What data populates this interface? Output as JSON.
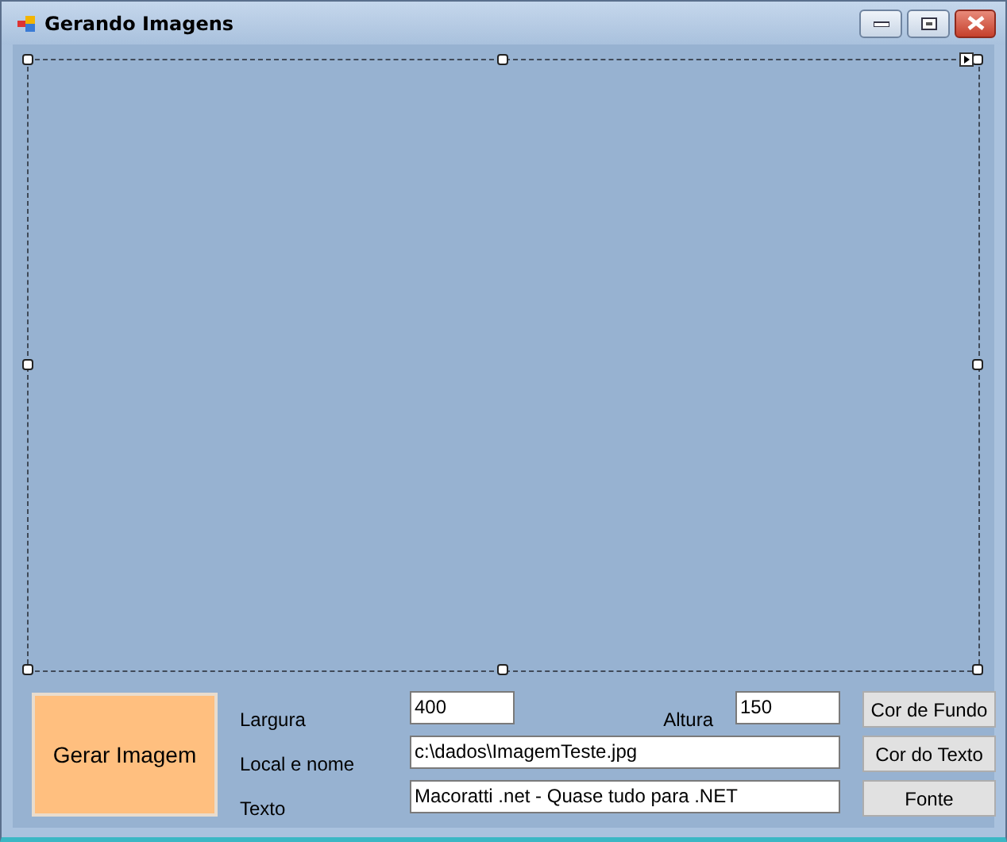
{
  "window": {
    "title": "Gerando Imagens"
  },
  "picture_box": {
    "selected": true
  },
  "generate_button": {
    "label": "Gerar Imagem"
  },
  "width_field": {
    "label": "Largura",
    "value": "400"
  },
  "height_field": {
    "label": "Altura",
    "value": "150"
  },
  "path_field": {
    "label": "Local e nome",
    "value": "c:\\dados\\ImagemTeste.jpg"
  },
  "text_field": {
    "label": "Texto",
    "value": "Macoratti .net - Quase tudo para .NET"
  },
  "side_buttons": [
    "Cor de Fundo",
    "Cor do Texto",
    "Fonte"
  ]
}
